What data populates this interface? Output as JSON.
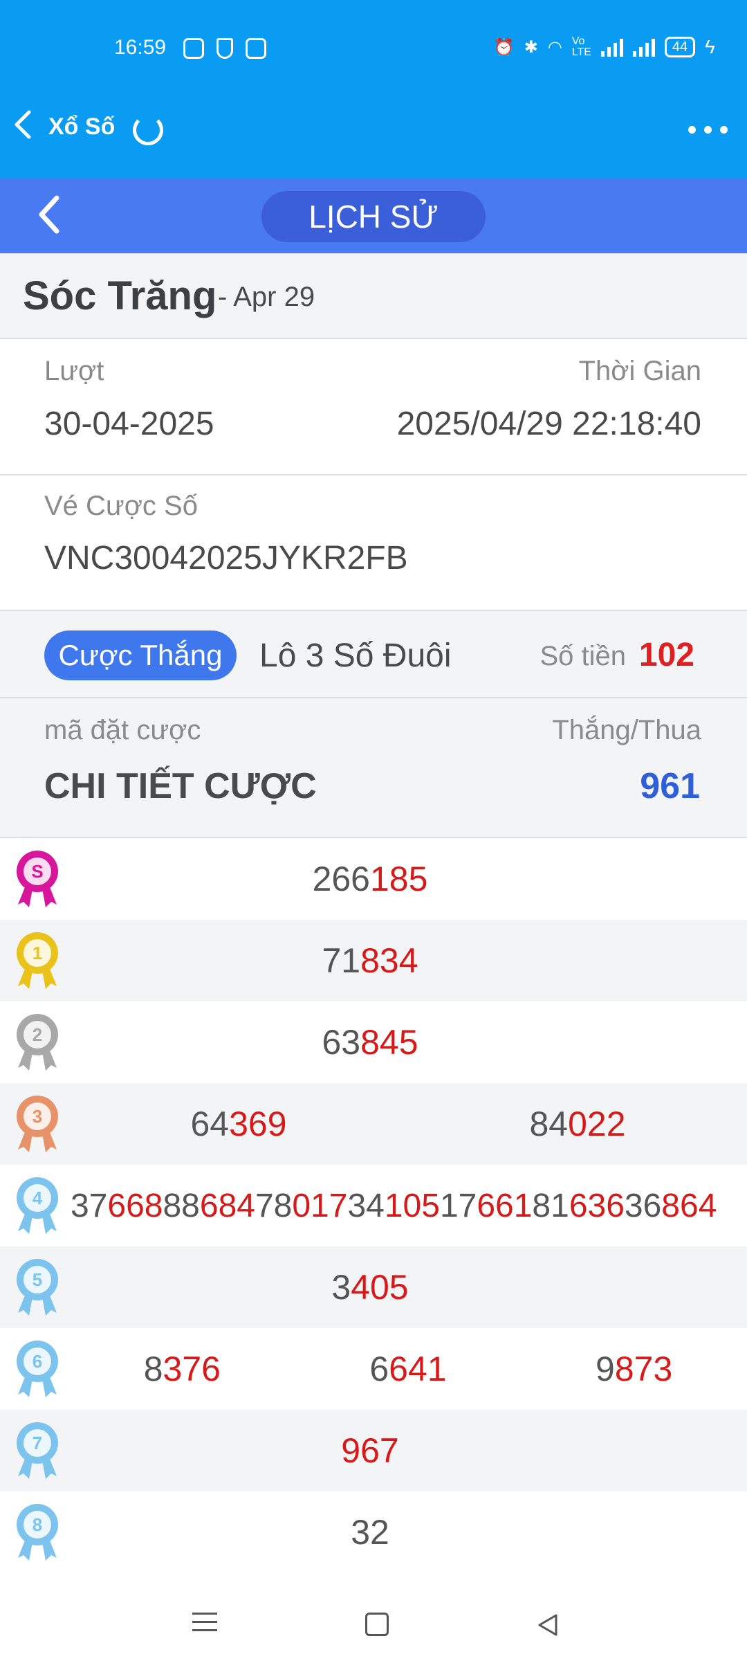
{
  "status_bar": {
    "time": "16:59",
    "battery": "44",
    "icons": [
      "alarm-icon",
      "bluetooth-icon",
      "wifi-icon",
      "volte-icon",
      "signal-icon",
      "signal-icon",
      "battery-icon",
      "charging-icon"
    ]
  },
  "app_bar": {
    "title": "Xổ Số",
    "icons": [
      "back-chevron-icon",
      "refresh-icon",
      "more-dots-icon"
    ]
  },
  "subheader": {
    "tab_label": "LỊCH SỬ"
  },
  "title": {
    "name": "Sóc Trăng",
    "date": "- Apr 29"
  },
  "info": {
    "turn_label": "Lượt",
    "turn_value": "30-04-2025",
    "time_label": "Thời Gian",
    "time_value": "2025/04/29 22:18:40",
    "ticket_label": "Vé Cược Số",
    "ticket_value": "VNC30042025JYKR2FB"
  },
  "bet": {
    "status": "Cược Thắng",
    "type": "Lô 3 Số Đuôi",
    "amount_label": "Số tiền",
    "amount": "102"
  },
  "detail": {
    "code_label": "mã đặt cược",
    "result_label": "Thắng/Thua",
    "title": "CHI TIẾT CƯỢC",
    "result_value": "961"
  },
  "colors": {
    "status_blue": "#0a9cf2",
    "header_blue": "#4a7af2",
    "pill_blue": "#3f78ec",
    "highlight_red": "#d61a1a",
    "win_blue": "#2e5fd8"
  },
  "prizes": [
    {
      "medal": "S",
      "medal_color": "#d6179b",
      "numbers": [
        [
          "266",
          "185"
        ]
      ]
    },
    {
      "medal": "1",
      "medal_color": "#e9c21a",
      "numbers": [
        [
          "71",
          "834"
        ]
      ]
    },
    {
      "medal": "2",
      "medal_color": "#a8a8a8",
      "numbers": [
        [
          "63",
          "845"
        ]
      ]
    },
    {
      "medal": "3",
      "medal_color": "#e8926a",
      "numbers": [
        [
          "64",
          "369"
        ],
        [
          "84",
          "022"
        ]
      ]
    },
    {
      "medal": "4",
      "medal_color": "#7cc4ee",
      "numbers": [
        [
          "37",
          "668"
        ],
        [
          "88",
          "684"
        ],
        [
          "78",
          "017"
        ],
        [
          "34",
          "105"
        ],
        [
          "17",
          "661"
        ],
        [
          "81",
          "636"
        ],
        [
          "36",
          "864"
        ]
      ]
    },
    {
      "medal": "5",
      "medal_color": "#7cc4ee",
      "numbers": [
        [
          "3",
          "405"
        ]
      ]
    },
    {
      "medal": "6",
      "medal_color": "#7cc4ee",
      "numbers": [
        [
          "8",
          "376"
        ],
        [
          "6",
          "641"
        ],
        [
          "9",
          "873"
        ]
      ]
    },
    {
      "medal": "7",
      "medal_color": "#7cc4ee",
      "numbers": [
        [
          "",
          "967"
        ]
      ]
    },
    {
      "medal": "8",
      "medal_color": "#7cc4ee",
      "numbers": [
        [
          "32",
          ""
        ]
      ]
    }
  ]
}
